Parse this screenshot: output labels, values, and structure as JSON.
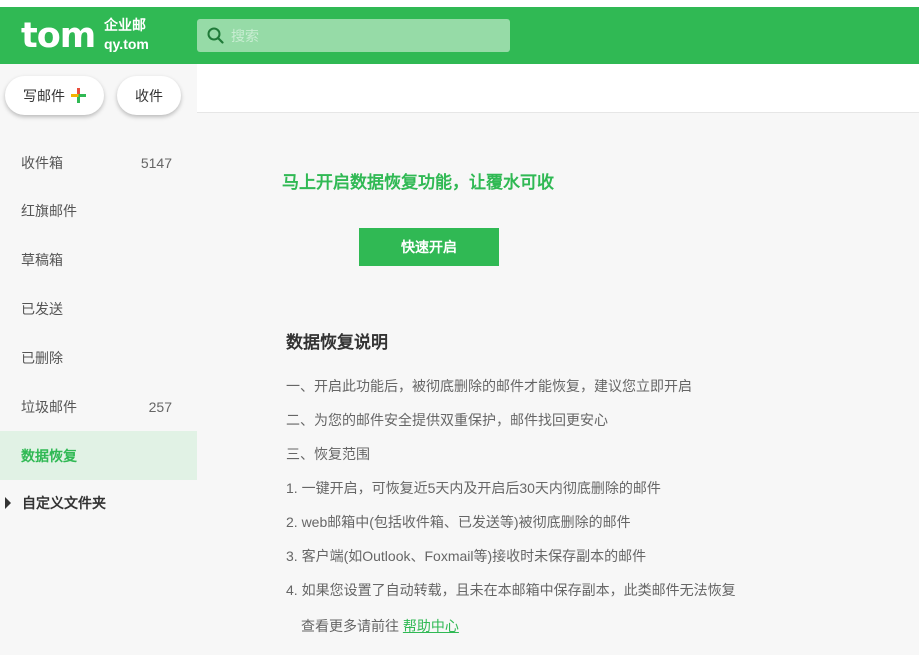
{
  "header": {
    "logo_main": "tom",
    "logo_sub_line1": "企业邮",
    "logo_sub_line2": "qy.tom",
    "search_placeholder": "搜索",
    "brand_color": "#30b954"
  },
  "sidebar": {
    "compose_label": "写邮件",
    "receive_label": "收件",
    "folders": [
      {
        "label": "收件箱",
        "count": "5147"
      },
      {
        "label": "红旗邮件",
        "count": ""
      },
      {
        "label": "草稿箱",
        "count": ""
      },
      {
        "label": "已发送",
        "count": ""
      },
      {
        "label": "已删除",
        "count": ""
      },
      {
        "label": "垃圾邮件",
        "count": "257"
      },
      {
        "label": "数据恢复",
        "count": "",
        "active": true
      }
    ],
    "custom_folder_label": "自定义文件夹"
  },
  "main": {
    "promo_text": "马上开启数据恢复功能，让覆水可收",
    "quick_enable_label": "快速开启",
    "explain_title": "数据恢复说明",
    "lines": [
      "一、开启此功能后，被彻底删除的邮件才能恢复，建议您立即开启",
      "二、为您的邮件安全提供双重保护，邮件找回更安心",
      "三、恢复范围",
      "1. 一键开启，可恢复近5天内及开启后30天内彻底删除的邮件",
      "2. web邮箱中(包括收件箱、已发送等)被彻底删除的邮件",
      "3. 客户端(如Outlook、Foxmail等)接收时未保存副本的邮件",
      "4. 如果您设置了自动转载，且未在本邮箱中保存副本，此类邮件无法恢复"
    ],
    "help_prefix": "查看更多请前往",
    "help_link": "帮助中心"
  }
}
